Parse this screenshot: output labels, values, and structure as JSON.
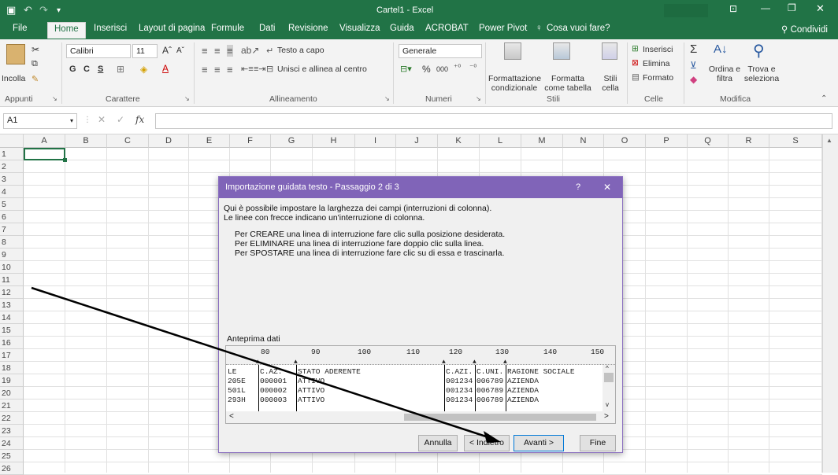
{
  "titlebar": {
    "title": "Cartel1  -  Excel"
  },
  "tabs": [
    "File",
    "Home",
    "Inserisci",
    "Layout di pagina",
    "Formule",
    "Dati",
    "Revisione",
    "Visualizza",
    "Guida",
    "ACROBAT",
    "Power Pivot"
  ],
  "tell_me": "Cosa vuoi fare?",
  "share": "Condividi",
  "ribbon": {
    "clipboard": {
      "paste": "Incolla",
      "group": "Appunti"
    },
    "font": {
      "name": "Calibri",
      "size": "11",
      "bold": "G",
      "italic": "C",
      "underline": "S",
      "group": "Carattere"
    },
    "alignment": {
      "wrap": "Testo a capo",
      "merge": "Unisci e allinea al centro",
      "group": "Allineamento"
    },
    "number": {
      "format": "Generale",
      "percent": "%",
      "thousands": "000",
      "group": "Numeri"
    },
    "styles": {
      "conditional": "Formattazione condizionale",
      "table": "Formatta come tabella",
      "cell": "Stili cella",
      "group": "Stili"
    },
    "cells": {
      "insert": "Inserisci",
      "delete": "Elimina",
      "format": "Formato",
      "group": "Celle"
    },
    "editing": {
      "sort": "Ordina e filtra",
      "find": "Trova e seleziona",
      "group": "Modifica"
    }
  },
  "formula": {
    "namebox": "A1",
    "fx": "fx",
    "value": ""
  },
  "columns": [
    "A",
    "B",
    "C",
    "D",
    "E",
    "F",
    "G",
    "H",
    "I",
    "J",
    "K",
    "L",
    "M",
    "N",
    "O",
    "P",
    "Q",
    "R",
    "S"
  ],
  "rows": [
    "1",
    "2",
    "3",
    "4",
    "5",
    "6",
    "7",
    "8",
    "9",
    "10",
    "11",
    "12",
    "13",
    "14",
    "15",
    "16",
    "17",
    "18",
    "19",
    "20",
    "21",
    "22",
    "23",
    "24",
    "25",
    "26"
  ],
  "dialog": {
    "title": "Importazione guidata testo - Passaggio 2 di 3",
    "help": "?",
    "close": "✕",
    "intro1": "Qui è possibile impostare la larghezza dei campi (interruzioni di colonna).",
    "intro2": "Le linee con frecce indicano un'interruzione di colonna.",
    "instr1": "Per CREARE una linea di interruzione fare clic sulla posizione desiderata.",
    "instr2": "Per ELIMINARE una linea di interruzione fare doppio clic sulla linea.",
    "instr3": "Per SPOSTARE una linea di interruzione fare clic su di essa e trascinarla.",
    "preview_label": "Anteprima dati",
    "ruler": [
      "80",
      "90",
      "100",
      "110",
      "120",
      "130",
      "140",
      "150"
    ],
    "preview": [
      [
        "LE",
        "C.AZ.",
        "STATO ADERENTE",
        "C.AZI.",
        "C.UNI.",
        "RAGIONE SOCIALE"
      ],
      [
        "205E",
        "000001",
        "ATTIVO",
        "001234",
        "006789",
        "AZIENDA"
      ],
      [
        "501L",
        "000002",
        "ATTIVO",
        "001234",
        "006789",
        "AZIENDA"
      ],
      [
        "293H",
        "000003",
        "ATTIVO",
        "001234",
        "006789",
        "AZIENDA"
      ]
    ],
    "buttons": {
      "cancel": "Annulla",
      "back": "< Indietro",
      "next": "Avanti >",
      "finish": "Fine"
    }
  },
  "colors": {
    "excel_green": "#217346",
    "dialog_purple": "#8064b8"
  }
}
